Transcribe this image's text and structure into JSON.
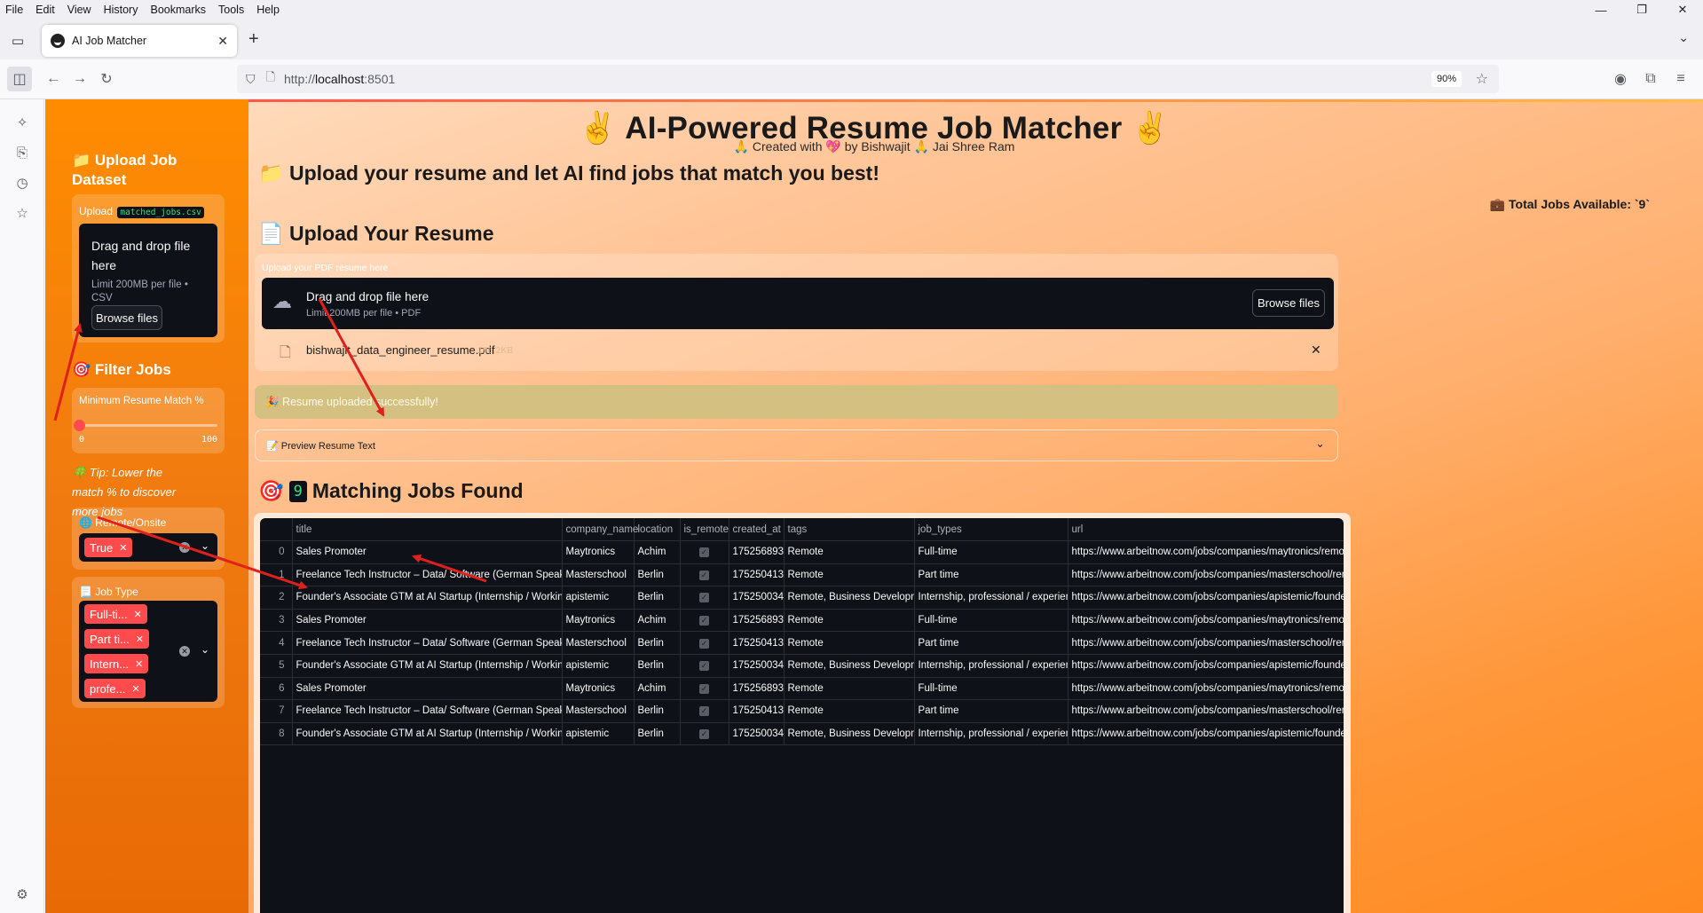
{
  "browser": {
    "menu": [
      "File",
      "Edit",
      "View",
      "History",
      "Bookmarks",
      "Tools",
      "Help"
    ],
    "tab_title": "AI Job Matcher",
    "url_prefix": "http://",
    "url_host": "localhost",
    "url_port": ":8501",
    "zoom": "90%"
  },
  "sidebar": {
    "upload_heading": "📁 Upload Job Dataset",
    "upload_label": "Upload",
    "upload_code": "matched_jobs.csv",
    "dropzone_title": "Drag and drop file here",
    "dropzone_limit": "Limit 200MB per file • CSV",
    "browse_label": "Browse files",
    "filter_heading": "🎯 Filter Jobs",
    "slider_label": "Minimum Resume Match %",
    "slider_value": 0,
    "slider_min": "0",
    "slider_max": "100",
    "tip": "🍀 Tip: Lower the match % to discover more jobs",
    "remote_label": "🌐 Remote/Onsite",
    "remote_chips": [
      "True"
    ],
    "jobtype_label": "📃 Job Type",
    "jobtype_chips": [
      "Full-ti...",
      "Part ti...",
      "Intern...",
      "profe..."
    ]
  },
  "main": {
    "title": "✌️ AI-Powered Resume Job Matcher ✌️",
    "subtitle": "🙏 Created with 💖 by Bishwajit 🙏 Jai Shree Ram",
    "tagline": "📁 Upload your resume and let AI find jobs that match you best!",
    "total_jobs": "💼 Total Jobs Available: `9`",
    "upload_heading": "📄 Upload Your Resume",
    "upload_label": "Upload your PDF resume here",
    "dropzone_title": "Drag and drop file here",
    "dropzone_limit": "Limit 200MB per file • PDF",
    "browse_label": "Browse files",
    "file_name": "bishwajit_data_engineer_resume.pdf",
    "file_size": "196.2KB",
    "success_msg": "🎉 Resume uploaded successfully!",
    "expander_label": "📝 Preview Resume Text",
    "matches_count": "9",
    "matches_label": "Matching Jobs Found"
  },
  "table": {
    "columns": [
      "",
      "title",
      "company_name",
      "location",
      "is_remote",
      "created_at",
      "tags",
      "job_types",
      "url"
    ],
    "rows": [
      [
        "0",
        "Sales Promoter",
        "Maytronics",
        "Achim",
        true,
        "1752568930",
        "Remote",
        "Full-time",
        "https://www.arbeitnow.com/jobs/companies/maytronics/remote-sales-p"
      ],
      [
        "1",
        "Freelance Tech Instructor – Data/ Software (German Speaking))",
        "Masterschool",
        "Berlin",
        true,
        "1752504132",
        "Remote",
        "Part time",
        "https://www.arbeitnow.com/jobs/companies/masterschool/remote-free"
      ],
      [
        "2",
        "Founder's Associate GTM at AI Startup (Internship / Working Student)",
        "apistemic",
        "Berlin",
        true,
        "1752500344",
        "Remote, Business Development",
        "Internship, professional / experienced",
        "https://www.arbeitnow.com/jobs/companies/apistemic/founders-associ"
      ],
      [
        "3",
        "Sales Promoter",
        "Maytronics",
        "Achim",
        true,
        "1752568930",
        "Remote",
        "Full-time",
        "https://www.arbeitnow.com/jobs/companies/maytronics/remote-sales-p"
      ],
      [
        "4",
        "Freelance Tech Instructor – Data/ Software (German Speaking))",
        "Masterschool",
        "Berlin",
        true,
        "1752504132",
        "Remote",
        "Part time",
        "https://www.arbeitnow.com/jobs/companies/masterschool/remote-free"
      ],
      [
        "5",
        "Founder's Associate GTM at AI Startup (Internship / Working Student)",
        "apistemic",
        "Berlin",
        true,
        "1752500344",
        "Remote, Business Development",
        "Internship, professional / experienced",
        "https://www.arbeitnow.com/jobs/companies/apistemic/founders-associ"
      ],
      [
        "6",
        "Sales Promoter",
        "Maytronics",
        "Achim",
        true,
        "1752568930",
        "Remote",
        "Full-time",
        "https://www.arbeitnow.com/jobs/companies/maytronics/remote-sales-p"
      ],
      [
        "7",
        "Freelance Tech Instructor – Data/ Software (German Speaking))",
        "Masterschool",
        "Berlin",
        true,
        "1752504132",
        "Remote",
        "Part time",
        "https://www.arbeitnow.com/jobs/companies/masterschool/remote-free"
      ],
      [
        "8",
        "Founder's Associate GTM at AI Startup (Internship / Working Student)",
        "apistemic",
        "Berlin",
        true,
        "1752500344",
        "Remote, Business Development",
        "Internship, professional / experienced",
        "https://www.arbeitnow.com/jobs/companies/apistemic/founders-associ"
      ]
    ]
  },
  "colors": {
    "accent": "#ff4b4b",
    "sidebar_bg": "#ff8c00",
    "annotation_arrow": "#e0201c"
  }
}
